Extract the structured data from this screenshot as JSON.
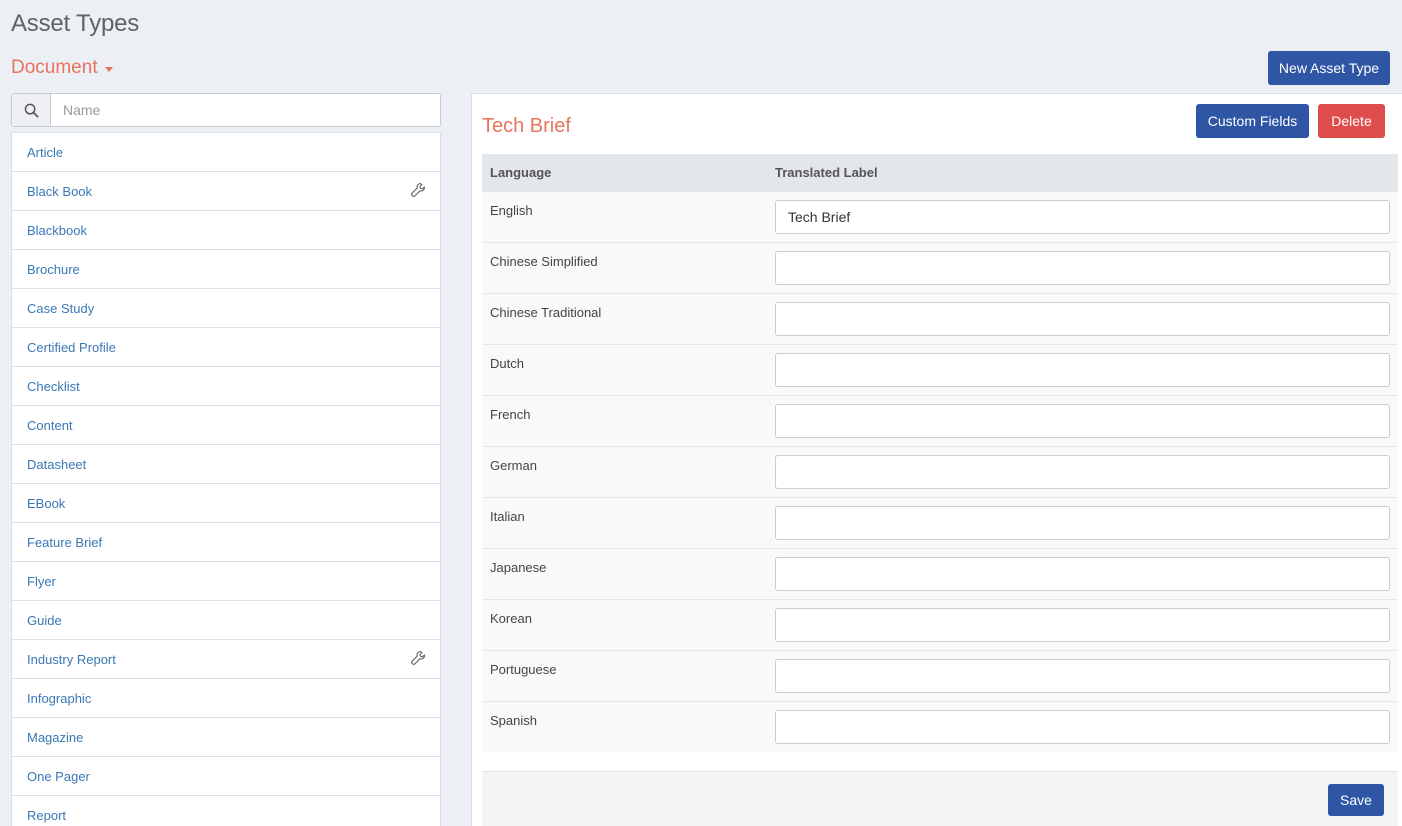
{
  "page": {
    "title": "Asset Types",
    "category_dropdown": "Document",
    "new_button": "New Asset Type"
  },
  "search": {
    "placeholder": "Name",
    "value": ""
  },
  "asset_types": [
    {
      "label": "Article",
      "wrench": false
    },
    {
      "label": "Black Book",
      "wrench": true
    },
    {
      "label": "Blackbook",
      "wrench": false
    },
    {
      "label": "Brochure",
      "wrench": false
    },
    {
      "label": "Case Study",
      "wrench": false
    },
    {
      "label": "Certified Profile",
      "wrench": false
    },
    {
      "label": "Checklist",
      "wrench": false
    },
    {
      "label": "Content",
      "wrench": false
    },
    {
      "label": "Datasheet",
      "wrench": false
    },
    {
      "label": "EBook",
      "wrench": false
    },
    {
      "label": "Feature Brief",
      "wrench": false
    },
    {
      "label": "Flyer",
      "wrench": false
    },
    {
      "label": "Guide",
      "wrench": false
    },
    {
      "label": "Industry Report",
      "wrench": true
    },
    {
      "label": "Infographic",
      "wrench": false
    },
    {
      "label": "Magazine",
      "wrench": false
    },
    {
      "label": "One Pager",
      "wrench": false
    },
    {
      "label": "Report",
      "wrench": false
    }
  ],
  "detail": {
    "title": "Tech Brief",
    "custom_fields_button": "Custom Fields",
    "delete_button": "Delete",
    "columns": {
      "language": "Language",
      "translated_label": "Translated Label"
    },
    "rows": [
      {
        "language": "English",
        "value": "Tech Brief"
      },
      {
        "language": "Chinese Simplified",
        "value": ""
      },
      {
        "language": "Chinese Traditional",
        "value": ""
      },
      {
        "language": "Dutch",
        "value": ""
      },
      {
        "language": "French",
        "value": ""
      },
      {
        "language": "German",
        "value": ""
      },
      {
        "language": "Italian",
        "value": ""
      },
      {
        "language": "Japanese",
        "value": ""
      },
      {
        "language": "Korean",
        "value": ""
      },
      {
        "language": "Portuguese",
        "value": ""
      },
      {
        "language": "Spanish",
        "value": ""
      }
    ],
    "save_button": "Save"
  },
  "colors": {
    "accent": "#e8735f",
    "primary": "#2e56a4",
    "danger": "#de4c4c",
    "link": "#3a78b5",
    "background": "#eceff4"
  }
}
